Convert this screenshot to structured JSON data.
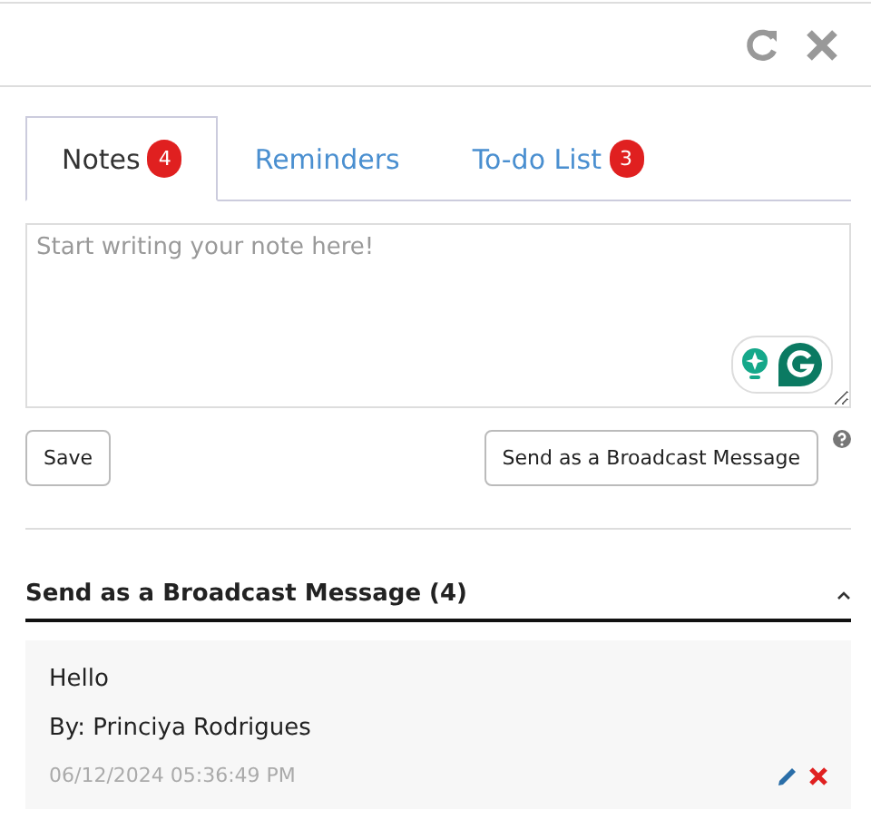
{
  "tabs": [
    {
      "label": "Notes",
      "badge": "4",
      "selected": true
    },
    {
      "label": "Reminders",
      "selected": false
    },
    {
      "label": "To-do List",
      "badge": "3",
      "selected": false
    }
  ],
  "note_field": {
    "placeholder": "Start writing your note here!"
  },
  "buttons": {
    "save": "Save",
    "broadcast": "Send as a Broadcast Message"
  },
  "section": {
    "title": "Send as a Broadcast Message (4)",
    "expanded": true
  },
  "notes": [
    {
      "text": "Hello",
      "author": "By: Princiya Rodrigues",
      "time": "06/12/2024 05:36:49 PM"
    }
  ]
}
